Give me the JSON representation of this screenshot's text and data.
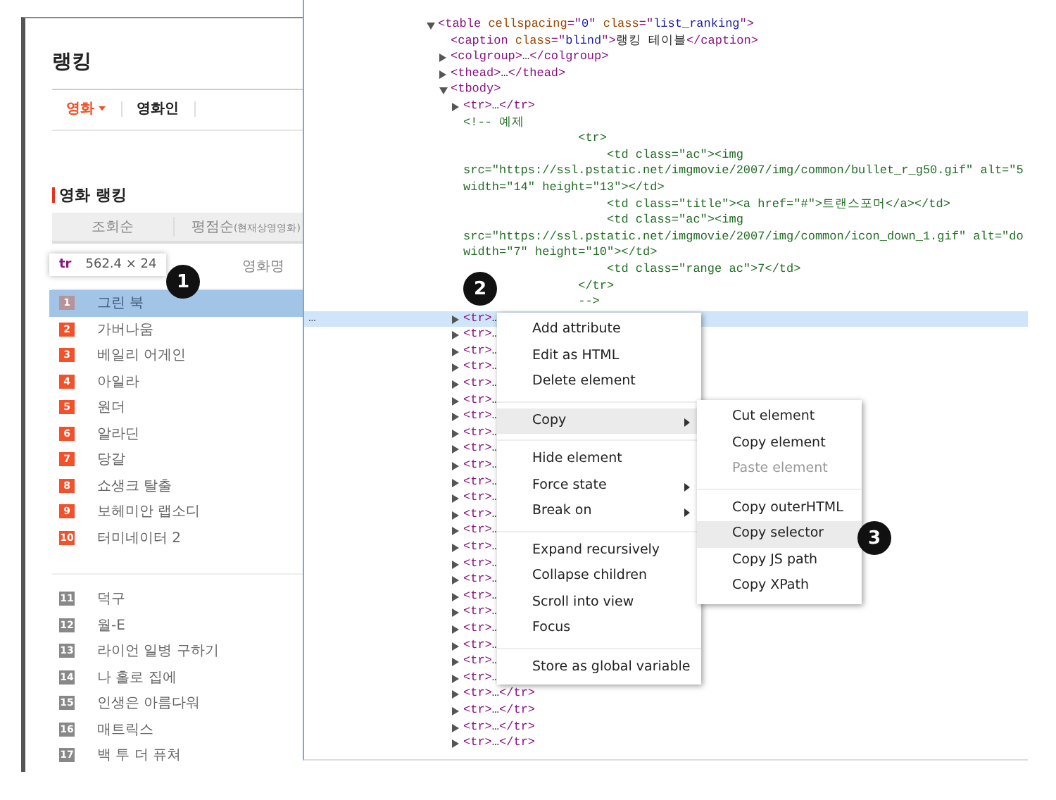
{
  "ranking_page": {
    "title": "랭킹",
    "tabs": [
      {
        "label": "영화",
        "selected": true,
        "dropdown": true
      },
      {
        "label": "영화인",
        "selected": false,
        "dropdown": false
      }
    ],
    "section_title": "영화 랭킹",
    "sort_tabs": [
      {
        "label": "조회순"
      },
      {
        "label": "평점순",
        "note": "(현재상영영화)"
      }
    ],
    "column_header": "영화명",
    "top_rankings": [
      {
        "rank": "1",
        "title": "그린 북",
        "selected": true
      },
      {
        "rank": "2",
        "title": "가버나움",
        "selected": false
      },
      {
        "rank": "3",
        "title": "베일리 어게인",
        "selected": false
      },
      {
        "rank": "4",
        "title": "아일라",
        "selected": false
      },
      {
        "rank": "5",
        "title": "원더",
        "selected": false
      },
      {
        "rank": "6",
        "title": "알라딘",
        "selected": false
      },
      {
        "rank": "7",
        "title": "당갈",
        "selected": false
      },
      {
        "rank": "8",
        "title": "쇼생크 탈출",
        "selected": false
      },
      {
        "rank": "9",
        "title": "보헤미안 랩소디",
        "selected": false
      },
      {
        "rank": "10",
        "title": "터미네이터 2",
        "selected": false
      }
    ],
    "more_rankings": [
      {
        "rank": "11",
        "title": "덕구",
        "selected": false
      },
      {
        "rank": "12",
        "title": "월-E",
        "selected": false
      },
      {
        "rank": "13",
        "title": "라이언 일병 구하기",
        "selected": false
      },
      {
        "rank": "14",
        "title": "나 홀로 집에",
        "selected": false
      },
      {
        "rank": "15",
        "title": "인생은 아름다워",
        "selected": false
      },
      {
        "rank": "16",
        "title": "매트릭스",
        "selected": false
      },
      {
        "rank": "17",
        "title": "백 투 더 퓨쳐",
        "selected": false
      }
    ],
    "element_tooltip": {
      "tag": "tr",
      "size": "562.4 × 24"
    }
  },
  "elements_panel": {
    "tree": [
      {
        "expanded": true,
        "segments": [
          {
            "kind": "tag",
            "text": "<table"
          },
          {
            "kind": "attr",
            "text": " cellspacing"
          },
          {
            "kind": "tag",
            "text": "=\""
          },
          {
            "kind": "value",
            "text": "0"
          },
          {
            "kind": "tag",
            "text": "\""
          },
          {
            "kind": "attr",
            "text": " class"
          },
          {
            "kind": "tag",
            "text": "=\""
          },
          {
            "kind": "value",
            "text": "list_ranking"
          },
          {
            "kind": "tag",
            "text": "\">"
          }
        ],
        "children": [
          {
            "segments": [
              {
                "kind": "tag",
                "text": "<caption"
              },
              {
                "kind": "attr",
                "text": " class"
              },
              {
                "kind": "tag",
                "text": "=\""
              },
              {
                "kind": "value",
                "text": "blind"
              },
              {
                "kind": "tag",
                "text": "\">"
              },
              {
                "kind": "text",
                "text": "랭킹 테이블"
              },
              {
                "kind": "tag",
                "text": "</caption>"
              }
            ]
          },
          {
            "expanded": false,
            "segments": [
              {
                "kind": "tag",
                "text": "<colgroup>"
              },
              {
                "kind": "text",
                "text": "…"
              },
              {
                "kind": "tag",
                "text": "</colgroup>"
              }
            ]
          },
          {
            "expanded": false,
            "segments": [
              {
                "kind": "tag",
                "text": "<thead>"
              },
              {
                "kind": "text",
                "text": "…"
              },
              {
                "kind": "tag",
                "text": "</thead>"
              }
            ]
          },
          {
            "expanded": true,
            "segments": [
              {
                "kind": "tag",
                "text": "<tbody>"
              }
            ],
            "children": [
              {
                "expanded": false,
                "selected": false,
                "segments": [
                  {
                    "kind": "tag",
                    "text": "<tr>"
                  },
                  {
                    "kind": "text",
                    "text": "…"
                  },
                  {
                    "kind": "tag",
                    "text": "</tr>"
                  }
                ]
              },
              {
                "comment": [
                  "<!-- 예제",
                  "                <tr>",
                  "                    <td class=\"ac\"><img",
                  "src=\"https://ssl.pstatic.net/imgmovie/2007/img/common/bullet_r_g50.gif\" alt=\"5",
                  "width=\"14\" height=\"13\"></td>",
                  "                    <td class=\"title\"><a href=\"#\">트랜스포머</a></td>",
                  "                    <td class=\"ac\"><img",
                  "src=\"https://ssl.pstatic.net/imgmovie/2007/img/common/icon_down_1.gif\" alt=\"do",
                  "width=\"7\" height=\"10\"></td>",
                  "                    <td class=\"range ac\">7</td>",
                  "                </tr>",
                  "                -->"
                ]
              },
              {
                "expanded": false,
                "selected": true,
                "gutter": "…",
                "segments": [
                  {
                    "kind": "tag",
                    "text": "<tr>"
                  },
                  {
                    "kind": "text",
                    "text": "…"
                  }
                ]
              },
              {
                "expanded": false,
                "selected": false,
                "segments": [
                  {
                    "kind": "tag",
                    "text": "<tr>"
                  },
                  {
                    "kind": "text",
                    "text": "…"
                  }
                ]
              },
              {
                "expanded": false,
                "selected": false,
                "segments": [
                  {
                    "kind": "tag",
                    "text": "<tr>"
                  },
                  {
                    "kind": "text",
                    "text": "…"
                  }
                ]
              },
              {
                "expanded": false,
                "selected": false,
                "segments": [
                  {
                    "kind": "tag",
                    "text": "<tr>"
                  },
                  {
                    "kind": "text",
                    "text": "…"
                  }
                ]
              },
              {
                "expanded": false,
                "selected": false,
                "segments": [
                  {
                    "kind": "tag",
                    "text": "<tr>"
                  },
                  {
                    "kind": "text",
                    "text": "…"
                  }
                ]
              },
              {
                "expanded": false,
                "selected": false,
                "segments": [
                  {
                    "kind": "tag",
                    "text": "<tr>"
                  },
                  {
                    "kind": "text",
                    "text": "…"
                  }
                ]
              },
              {
                "expanded": false,
                "selected": false,
                "segments": [
                  {
                    "kind": "tag",
                    "text": "<tr>"
                  },
                  {
                    "kind": "text",
                    "text": "…"
                  }
                ]
              },
              {
                "expanded": false,
                "selected": false,
                "segments": [
                  {
                    "kind": "tag",
                    "text": "<tr>"
                  },
                  {
                    "kind": "text",
                    "text": "…"
                  }
                ]
              },
              {
                "expanded": false,
                "selected": false,
                "segments": [
                  {
                    "kind": "tag",
                    "text": "<tr>"
                  },
                  {
                    "kind": "text",
                    "text": "…"
                  }
                ]
              },
              {
                "expanded": false,
                "selected": false,
                "segments": [
                  {
                    "kind": "tag",
                    "text": "<tr>"
                  },
                  {
                    "kind": "text",
                    "text": "…"
                  }
                ]
              },
              {
                "expanded": false,
                "selected": false,
                "segments": [
                  {
                    "kind": "tag",
                    "text": "<tr>"
                  },
                  {
                    "kind": "text",
                    "text": "…"
                  }
                ]
              },
              {
                "expanded": false,
                "selected": false,
                "segments": [
                  {
                    "kind": "tag",
                    "text": "<tr>"
                  },
                  {
                    "kind": "text",
                    "text": "…"
                  }
                ]
              },
              {
                "expanded": false,
                "selected": false,
                "segments": [
                  {
                    "kind": "tag",
                    "text": "<tr>"
                  },
                  {
                    "kind": "text",
                    "text": "…"
                  }
                ]
              },
              {
                "expanded": false,
                "selected": false,
                "segments": [
                  {
                    "kind": "tag",
                    "text": "<tr>"
                  },
                  {
                    "kind": "text",
                    "text": "…"
                  }
                ]
              },
              {
                "expanded": false,
                "selected": false,
                "segments": [
                  {
                    "kind": "tag",
                    "text": "<tr>"
                  },
                  {
                    "kind": "text",
                    "text": "…"
                  }
                ]
              },
              {
                "expanded": false,
                "selected": false,
                "segments": [
                  {
                    "kind": "tag",
                    "text": "<tr>"
                  },
                  {
                    "kind": "text",
                    "text": "…"
                  }
                ]
              },
              {
                "expanded": false,
                "selected": false,
                "segments": [
                  {
                    "kind": "tag",
                    "text": "<tr>"
                  },
                  {
                    "kind": "text",
                    "text": "…"
                  }
                ]
              },
              {
                "expanded": false,
                "selected": false,
                "segments": [
                  {
                    "kind": "tag",
                    "text": "<tr>"
                  },
                  {
                    "kind": "text",
                    "text": "…"
                  }
                ]
              },
              {
                "expanded": false,
                "selected": false,
                "segments": [
                  {
                    "kind": "tag",
                    "text": "<tr>"
                  },
                  {
                    "kind": "text",
                    "text": "…"
                  }
                ]
              },
              {
                "expanded": false,
                "selected": false,
                "segments": [
                  {
                    "kind": "tag",
                    "text": "<tr>"
                  },
                  {
                    "kind": "text",
                    "text": "…"
                  }
                ]
              },
              {
                "expanded": false,
                "selected": false,
                "segments": [
                  {
                    "kind": "tag",
                    "text": "<tr>"
                  },
                  {
                    "kind": "text",
                    "text": "…"
                  }
                ]
              },
              {
                "expanded": false,
                "selected": false,
                "segments": [
                  {
                    "kind": "tag",
                    "text": "<tr>"
                  },
                  {
                    "kind": "text",
                    "text": "…"
                  }
                ]
              },
              {
                "expanded": false,
                "selected": false,
                "segments": [
                  {
                    "kind": "tag",
                    "text": "<tr>"
                  },
                  {
                    "kind": "text",
                    "text": "…"
                  }
                ]
              },
              {
                "expanded": false,
                "selected": false,
                "segments": [
                  {
                    "kind": "tag",
                    "text": "<tr>"
                  },
                  {
                    "kind": "text",
                    "text": "…"
                  },
                  {
                    "kind": "tag",
                    "text": "</tr>"
                  }
                ]
              },
              {
                "expanded": false,
                "selected": false,
                "segments": [
                  {
                    "kind": "tag",
                    "text": "<tr>"
                  },
                  {
                    "kind": "text",
                    "text": "…"
                  },
                  {
                    "kind": "tag",
                    "text": "</tr>"
                  }
                ]
              },
              {
                "expanded": false,
                "selected": false,
                "segments": [
                  {
                    "kind": "tag",
                    "text": "<tr>"
                  },
                  {
                    "kind": "text",
                    "text": "…"
                  },
                  {
                    "kind": "tag",
                    "text": "</tr>"
                  }
                ]
              },
              {
                "expanded": false,
                "selected": false,
                "segments": [
                  {
                    "kind": "tag",
                    "text": "<tr>"
                  },
                  {
                    "kind": "text",
                    "text": "…"
                  },
                  {
                    "kind": "tag",
                    "text": "</tr>"
                  }
                ]
              }
            ]
          }
        ]
      }
    ],
    "context_menu": {
      "groups": [
        [
          {
            "label": "Add attribute",
            "submenu": false,
            "selected": false
          },
          {
            "label": "Edit as HTML",
            "submenu": false,
            "selected": false
          },
          {
            "label": "Delete element",
            "submenu": false,
            "selected": false
          }
        ],
        [
          {
            "label": "Copy",
            "submenu": true,
            "selected": true
          }
        ],
        [
          {
            "label": "Hide element",
            "submenu": false,
            "selected": false
          },
          {
            "label": "Force state",
            "submenu": true,
            "selected": false
          },
          {
            "label": "Break on",
            "submenu": true,
            "selected": false
          }
        ],
        [
          {
            "label": "Expand recursively",
            "submenu": false,
            "selected": false
          },
          {
            "label": "Collapse children",
            "submenu": false,
            "selected": false
          },
          {
            "label": "Scroll into view",
            "submenu": false,
            "selected": false
          },
          {
            "label": "Focus",
            "submenu": false,
            "selected": false
          }
        ],
        [
          {
            "label": "Store as global variable",
            "submenu": false,
            "selected": false
          }
        ]
      ],
      "submenu": {
        "groups": [
          [
            {
              "label": "Cut element",
              "disabled": false,
              "selected": false
            },
            {
              "label": "Copy element",
              "disabled": false,
              "selected": false
            },
            {
              "label": "Paste element",
              "disabled": true,
              "selected": false
            }
          ],
          [
            {
              "label": "Copy outerHTML",
              "disabled": false,
              "selected": false
            },
            {
              "label": "Copy selector",
              "disabled": false,
              "selected": true
            },
            {
              "label": "Copy JS path",
              "disabled": false,
              "selected": false
            },
            {
              "label": "Copy XPath",
              "disabled": false,
              "selected": false
            }
          ]
        ]
      }
    }
  },
  "callouts": [
    "1",
    "2",
    "3"
  ]
}
